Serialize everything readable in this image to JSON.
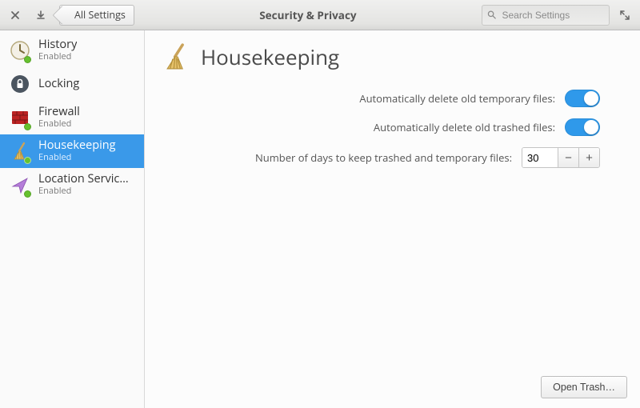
{
  "header": {
    "back_label": "All Settings",
    "title": "Security & Privacy",
    "search_placeholder": "Search Settings"
  },
  "sidebar": {
    "items": [
      {
        "name": "History",
        "sub": "Enabled",
        "has_sub": true,
        "selected": false,
        "icon": "history"
      },
      {
        "name": "Locking",
        "sub": "",
        "has_sub": false,
        "selected": false,
        "icon": "lock"
      },
      {
        "name": "Firewall",
        "sub": "Enabled",
        "has_sub": true,
        "selected": false,
        "icon": "firewall"
      },
      {
        "name": "Housekeeping",
        "sub": "Enabled",
        "has_sub": true,
        "selected": true,
        "icon": "broom"
      },
      {
        "name": "Location Servic…",
        "sub": "Enabled",
        "has_sub": true,
        "selected": false,
        "icon": "location"
      }
    ]
  },
  "main": {
    "title": "Housekeeping",
    "opt_temp_label": "Automatically delete old temporary files:",
    "opt_trash_label": "Automatically delete old trashed files:",
    "opt_days_label": "Number of days to keep trashed and temporary files:",
    "temp_on": true,
    "trash_on": true,
    "days_value": "30",
    "open_trash_label": "Open Trash…"
  }
}
